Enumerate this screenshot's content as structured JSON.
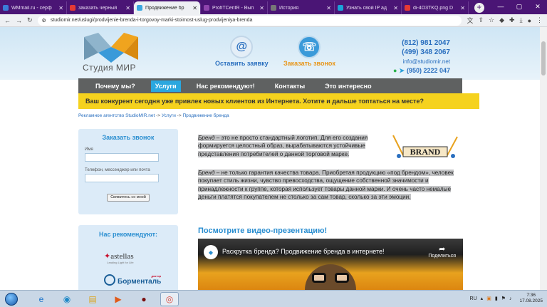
{
  "browser": {
    "tabs": [
      {
        "label": "WMmail.ru - серф",
        "color": "#3b7dd8",
        "active": false
      },
      {
        "label": "заказать черный",
        "color": "#e53935",
        "active": false
      },
      {
        "label": "Продвижение бр",
        "color": "#3aa7e0",
        "active": true
      },
      {
        "label": "ProfiTCentR - Вып",
        "color": "#8e44ad",
        "active": false
      },
      {
        "label": "История",
        "color": "#777777",
        "active": false
      },
      {
        "label": "Узнать свой IP ад",
        "color": "#1aa3d9",
        "active": false
      },
      {
        "label": "di-4O3TKQ.png D",
        "color": "#e53935",
        "active": false
      }
    ],
    "url": "studiomir.net/uslugi/prodvijenie-brenda-i-torgovoy-marki-stoimost-uslug-prodvijeniya-brenda"
  },
  "header": {
    "logo_text": "Студия МИР",
    "request_button": "Оставить заявку",
    "call_button": "Заказать звонок",
    "phone1": "(812) 981 2047",
    "phone2": "(499) 348 2067",
    "email": "info@studiomir.net",
    "mobile": "(950) 2222 047"
  },
  "nav": {
    "items": [
      "Почему мы?",
      "Услуги",
      "Нас рекомендуют!",
      "Контакты",
      "Это интересно"
    ],
    "active_index": 1
  },
  "banner": "Ваш конкурент сегодня уже привлек новых клиентов из Интернета. Хотите и дальше топтаться на месте?",
  "breadcrumb": [
    "Рекламное агентство StudioMIR.net",
    "Услуги",
    "Продвижение бренда"
  ],
  "callback_form": {
    "title": "Заказать звонок",
    "name_label": "Имя",
    "phone_label": "Телефон, мессенджер или почта",
    "submit": "Свяжитесь со мной"
  },
  "recommend": {
    "title": "Нас рекомендуют:",
    "partner1": "astellas",
    "partner1_sub": "Leading Light for Life",
    "partner2": "Борменталь",
    "partner2_sup": "доктор"
  },
  "content": {
    "p1_term": "Бренд",
    "p1_rest": " – это не просто стандартный логотип. Для его создания формируется целостный образ, вырабатываются устойчивые представления потребителей о данной торговой марке.",
    "p2_term": "Бренд",
    "p2_rest": " – не только гарантия качества товара. Приобретая продукцию «под брендом», человек покупает стиль жизни, чувство превосходства, ощущение собственной значимости и принадлежности к группе, которая использует товары данной марки. И очень часто немалые деньги платятся покупателем не столько за сам товар, сколько за эти эмоции.",
    "brand_image_text": "BRAND",
    "video_heading": "Посмотрите видео-презентацию!",
    "video_title": "Раскрутка бренда? Продвижение бренда в интернете!",
    "video_share": "Поделиться"
  },
  "taskbar": {
    "lang": "RU",
    "time": "7:36",
    "date": "17.08.2025"
  }
}
